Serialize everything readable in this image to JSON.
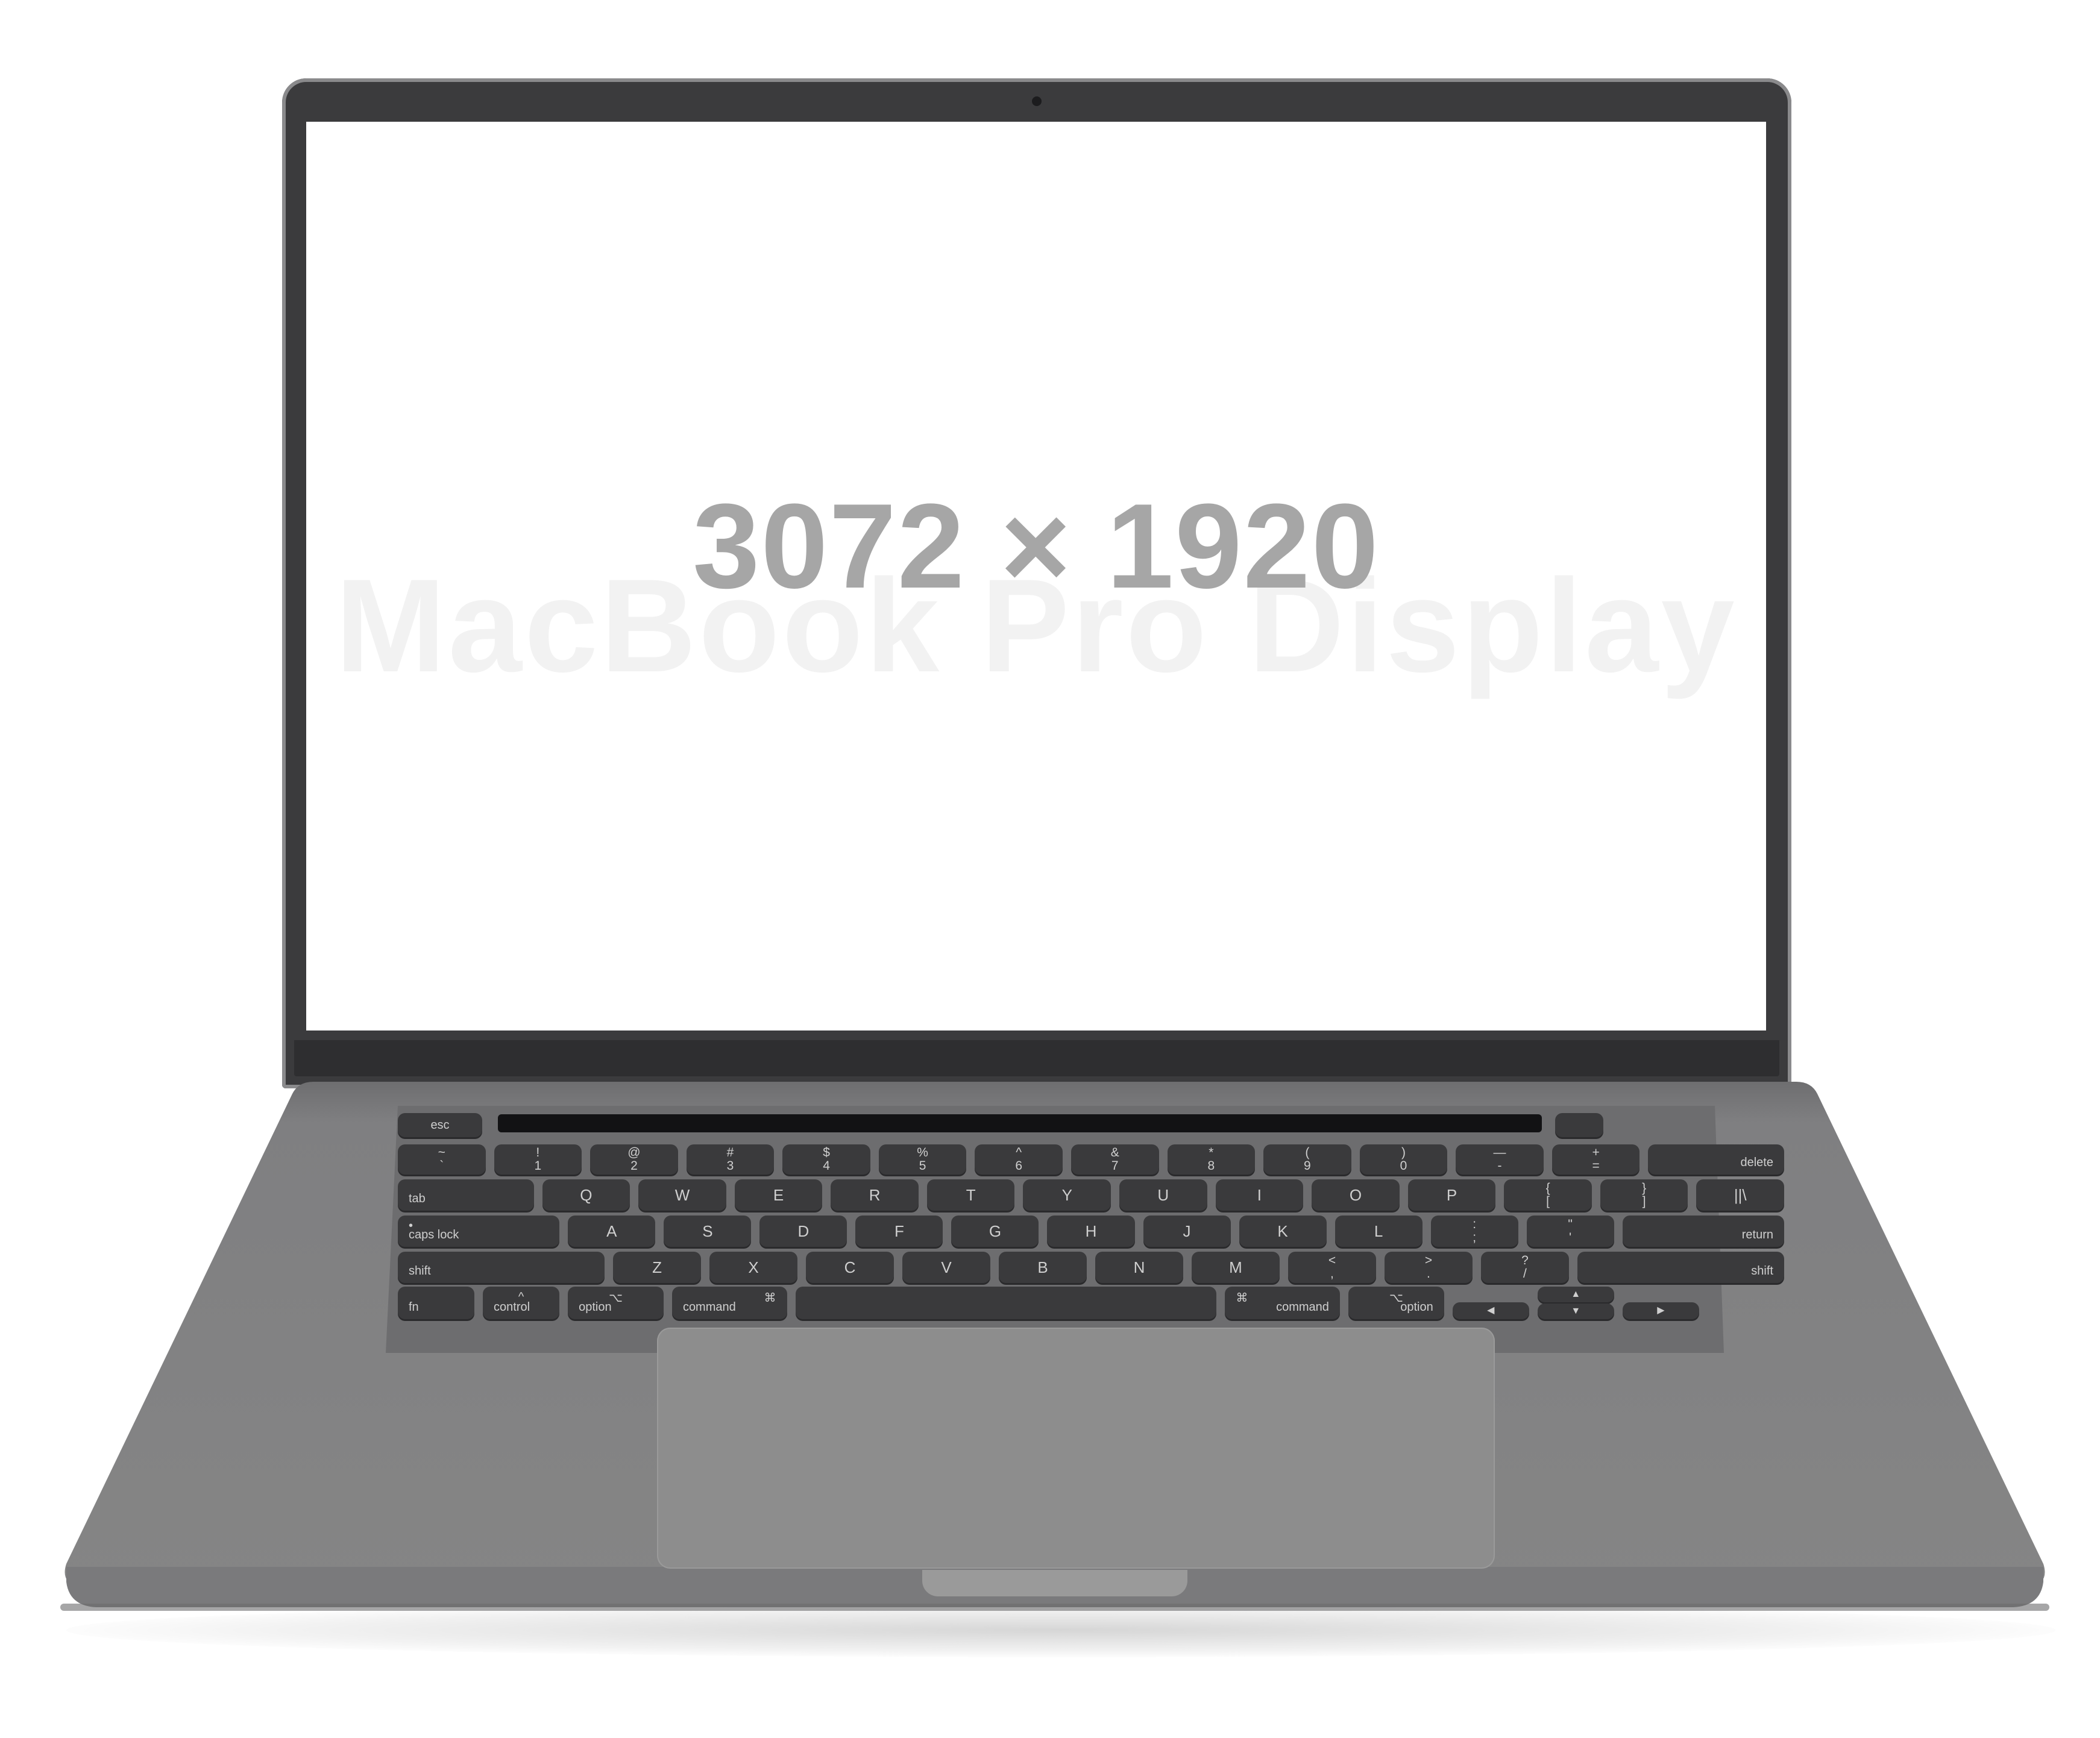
{
  "screen": {
    "dimensions_label": "3072 × 1920",
    "watermark_text": "MacBook Pro Display"
  },
  "colors": {
    "lid": "#3b3b3d",
    "chassis": "#808080",
    "key": "#3a3a3c",
    "screen": "#ffffff",
    "dimensions_text": "#a6a6a6"
  },
  "keyboard": {
    "rows": [
      [
        "esc"
      ],
      [
        "~|`",
        "!|1",
        "@|2",
        "#|3",
        "$|4",
        "%|5",
        "^|6",
        "&|7",
        "*|8",
        "(|9",
        ")|0",
        "—|-",
        "+|=",
        "delete"
      ],
      [
        "tab",
        "Q",
        "W",
        "E",
        "R",
        "T",
        "Y",
        "U",
        "I",
        "O",
        "P",
        "{|[",
        "}|]",
        "||\\"
      ],
      [
        "caps lock",
        "A",
        "S",
        "D",
        "F",
        "G",
        "H",
        "J",
        "K",
        "L",
        ":|;",
        "\"|'",
        "return"
      ],
      [
        "shift",
        "Z",
        "X",
        "C",
        "V",
        "B",
        "N",
        "M",
        "<|,",
        ">|.",
        "?|/",
        "shift"
      ],
      [
        "fn",
        "control",
        "option",
        "command",
        "",
        "command",
        "option",
        "◀",
        "▲",
        "▼",
        "▶"
      ]
    ]
  }
}
